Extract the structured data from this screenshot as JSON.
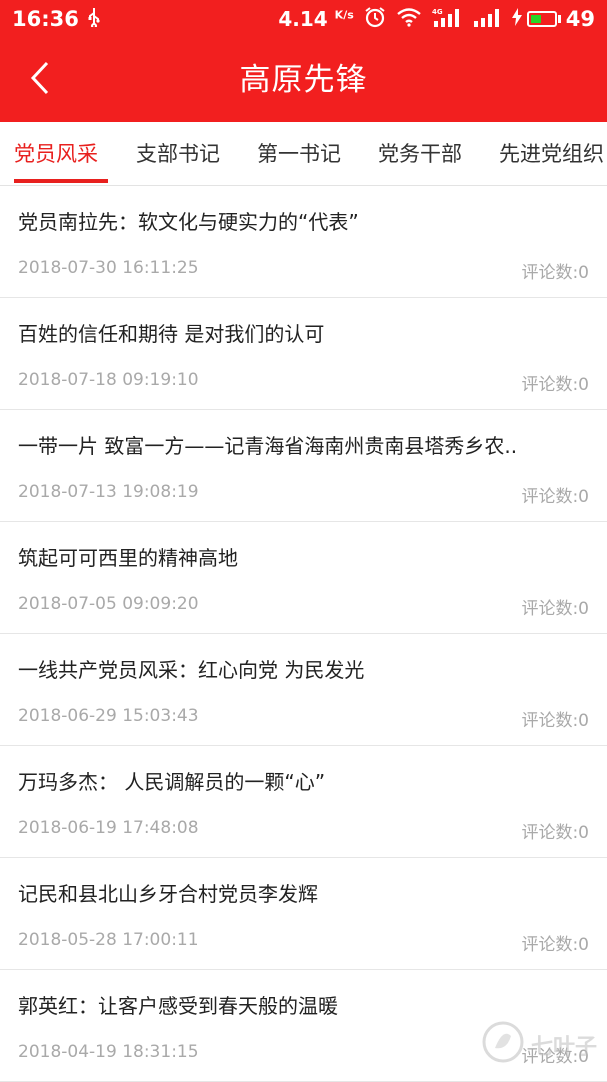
{
  "status_bar": {
    "time": "16:36",
    "usb_icon": "usb-icon",
    "speed": "4.14",
    "speed_unit": "K/s",
    "icons": [
      "alarm-icon",
      "wifi-icon",
      "signal-4g-icon",
      "signal-icon",
      "charging-icon"
    ],
    "battery_level": "49",
    "battery_fill_color": "#27d427"
  },
  "header": {
    "title": "高原先锋",
    "back_icon": "back-arrow-icon",
    "background_color": "#f21f1f"
  },
  "tabs": [
    {
      "label": "党员风采",
      "active": true
    },
    {
      "label": "支部书记",
      "active": false
    },
    {
      "label": "第一书记",
      "active": false
    },
    {
      "label": "党务干部",
      "active": false
    },
    {
      "label": "先进党组织",
      "active": false
    }
  ],
  "accent_color": "#e8201e",
  "articles": [
    {
      "title": "党员南拉先：软文化与硬实力的“代表”",
      "date": "2018-07-30 16:11:25",
      "comments": "评论数:0"
    },
    {
      "title": "百姓的信任和期待 是对我们的认可",
      "date": "2018-07-18 09:19:10",
      "comments": "评论数:0"
    },
    {
      "title": "一带一片 致富一方——记青海省海南州贵南县塔秀乡农..",
      "date": "2018-07-13 19:08:19",
      "comments": "评论数:0"
    },
    {
      "title": "筑起可可西里的精神高地",
      "date": "2018-07-05 09:09:20",
      "comments": "评论数:0"
    },
    {
      "title": "一线共产党员风采：红心向党 为民发光",
      "date": "2018-06-29 15:03:43",
      "comments": "评论数:0"
    },
    {
      "title": "万玛多杰： 人民调解员的一颗“心”",
      "date": "2018-06-19 17:48:08",
      "comments": "评论数:0"
    },
    {
      "title": "记民和县北山乡牙合村党员李发辉",
      "date": "2018-05-28 17:00:11",
      "comments": "评论数:0"
    },
    {
      "title": "郭英红：让客户感受到春天般的温暖",
      "date": "2018-04-19 18:31:15",
      "comments": "评论数:0"
    }
  ],
  "watermark": {
    "text": "七叶子",
    "icon": "leaf-logo-icon"
  }
}
